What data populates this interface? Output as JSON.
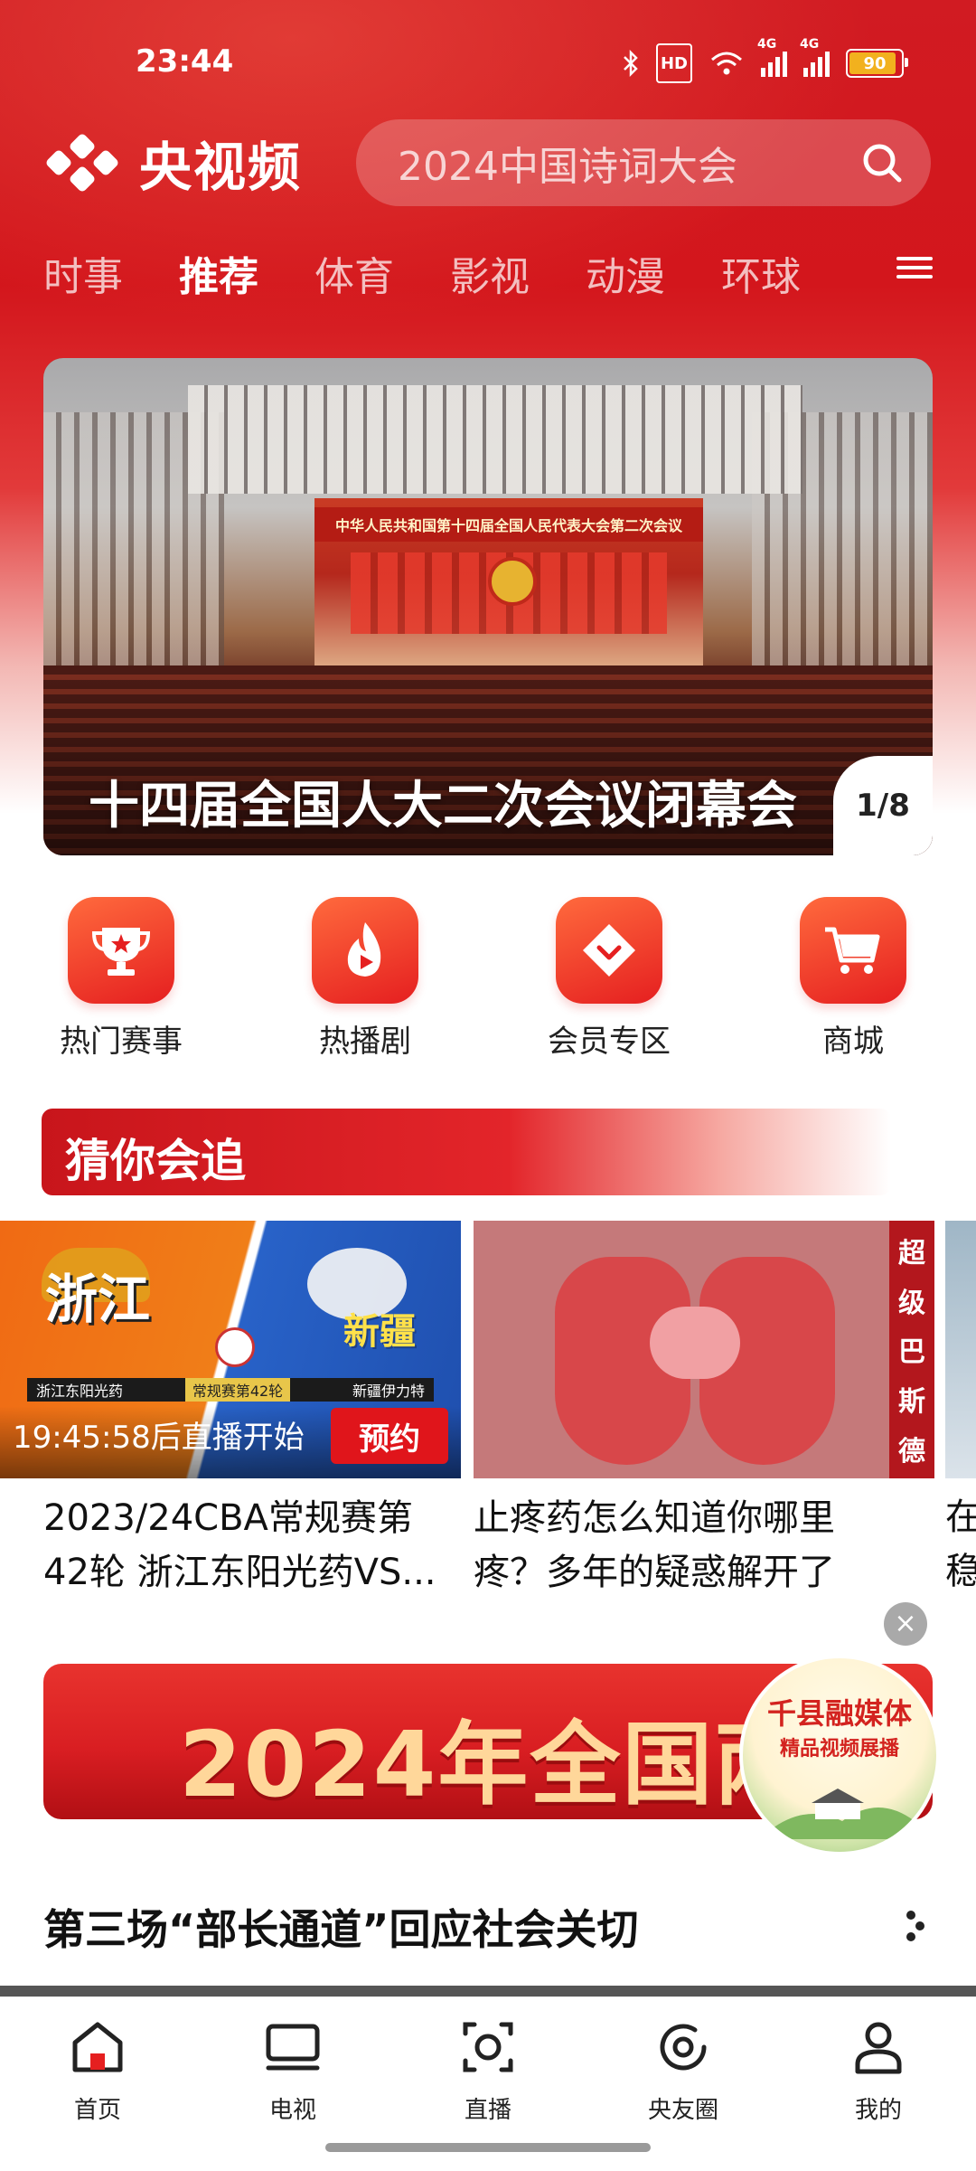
{
  "status_bar": {
    "time": "23:44",
    "hd_label": "HD",
    "signal1_label": "4G",
    "signal2_label": "4G",
    "battery": "90"
  },
  "header": {
    "app_name": "央视频",
    "search_placeholder": "2024中国诗词大会"
  },
  "tabs": [
    {
      "label": "时事",
      "active": false
    },
    {
      "label": "推荐",
      "active": true
    },
    {
      "label": "体育",
      "active": false
    },
    {
      "label": "影视",
      "active": false
    },
    {
      "label": "动漫",
      "active": false
    },
    {
      "label": "环球",
      "active": false
    }
  ],
  "banner": {
    "title": "十四届全国人大二次会议闭幕会",
    "stage_text": "中华人民共和国第十四届全国人民代表大会第二次会议",
    "page_indicator": "1/8"
  },
  "quick_entries": [
    {
      "label": "热门赛事",
      "icon": "trophy-icon"
    },
    {
      "label": "热播剧",
      "icon": "flame-icon"
    },
    {
      "label": "会员专区",
      "icon": "diamond-heart-icon"
    },
    {
      "label": "商城",
      "icon": "cart-icon"
    }
  ],
  "section": {
    "title": "猜你会追"
  },
  "cards": [
    {
      "title_line1": "2023/24CBA常规赛第",
      "title_line2": "42轮 浙江东阳光药VS...",
      "countdown": "19:45:58后直播开始",
      "action": "预约",
      "team_left": "浙江",
      "team_right": "新疆",
      "strip_left": "浙江东阳光药",
      "strip_mid": "常规赛第42轮",
      "strip_right": "新疆伊力特"
    },
    {
      "title_line1": "止疼药怎么知道你哪里",
      "title_line2": "疼？多年的疑惑解开了",
      "side_label": [
        "超",
        "级",
        "巴",
        "斯",
        "德"
      ]
    }
  ],
  "peek_card": {
    "title_line1": "在",
    "title_line2": "稳"
  },
  "ad": {
    "text": "2024年全国两会",
    "badge_line1": "千县融媒体",
    "badge_line2": "精品视频展播",
    "close": "×"
  },
  "subsection": {
    "title": "第三场“部长通道”回应社会关切"
  },
  "bottom_nav": [
    {
      "label": "首页",
      "icon": "home-icon",
      "active": true
    },
    {
      "label": "电视",
      "icon": "tv-icon",
      "active": false
    },
    {
      "label": "直播",
      "icon": "live-icon",
      "active": false
    },
    {
      "label": "央友圈",
      "icon": "circle-icon",
      "active": false
    },
    {
      "label": "我的",
      "icon": "profile-icon",
      "active": false
    }
  ],
  "colors": {
    "brand_red": "#d3161c",
    "accent_orange": "#ff6a3d",
    "battery_fill": "#f2b11e"
  }
}
